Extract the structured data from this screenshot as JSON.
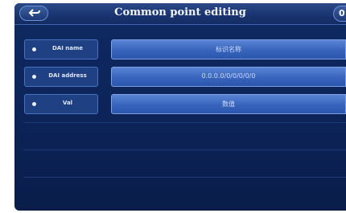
{
  "header": {
    "title": "Common point editing",
    "corner_label": "0"
  },
  "fields": [
    {
      "label": "DAI name",
      "value": "标识名称"
    },
    {
      "label": "DAI address",
      "value": "0.0.0.0/0/0/0/0/0"
    },
    {
      "label": "Val",
      "value": "数值"
    }
  ],
  "colors": {
    "screen_bg": "#0e2a63",
    "label_bg": "#1f4183",
    "value_bg": "#3a66bf",
    "title_text": "#f2f4fb"
  }
}
